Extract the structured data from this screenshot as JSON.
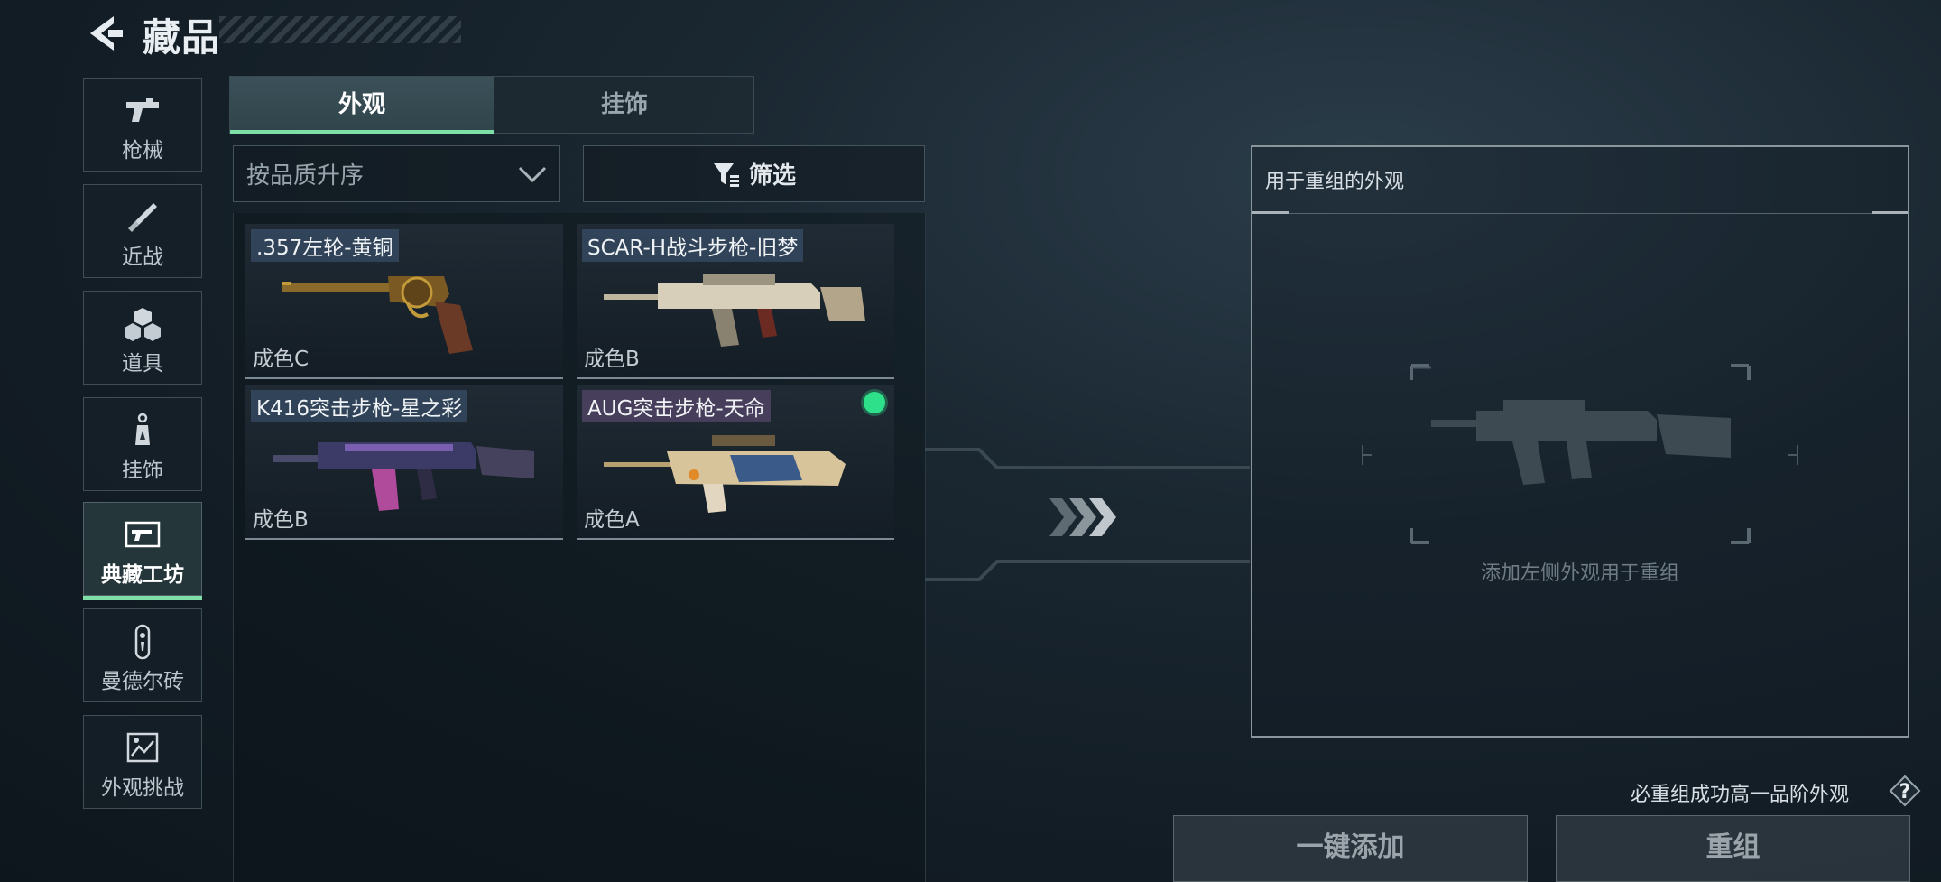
{
  "header": {
    "title": "藏品"
  },
  "nav": [
    {
      "label": "枪械",
      "icon": "pistol-icon"
    },
    {
      "label": "近战",
      "icon": "knife-icon"
    },
    {
      "label": "道具",
      "icon": "cubes-icon"
    },
    {
      "label": "挂饰",
      "icon": "charm-icon"
    },
    {
      "label": "典藏工坊",
      "icon": "workshop-icon",
      "active": true
    },
    {
      "label": "曼德尔砖",
      "icon": "brick-icon"
    },
    {
      "label": "外观挑战",
      "icon": "challenge-icon"
    }
  ],
  "tabs": [
    {
      "label": "外观",
      "active": true
    },
    {
      "label": "挂饰",
      "active": false
    }
  ],
  "sort": {
    "label": "按品质升序"
  },
  "filter": {
    "label": "筛选"
  },
  "items": [
    {
      "name": ".357左轮-黄铜",
      "condition": "成色C",
      "selected": false
    },
    {
      "name": "SCAR-H战斗步枪-旧梦",
      "condition": "成色B",
      "selected": false
    },
    {
      "name": "K416突击步枪-星之彩",
      "condition": "成色B",
      "selected": false
    },
    {
      "name": "AUG突击步枪-天命",
      "condition": "成色A",
      "selected": true
    }
  ],
  "recombine_panel": {
    "title": "用于重组的外观",
    "hint": "添加左侧外观用于重组"
  },
  "note": "必重组成功高一品阶外观",
  "buttons": {
    "add_all": "一键添加",
    "recombine": "重组"
  },
  "colors": {
    "accent": "#7ee0a6",
    "selected_dot": "#2fe08a"
  }
}
